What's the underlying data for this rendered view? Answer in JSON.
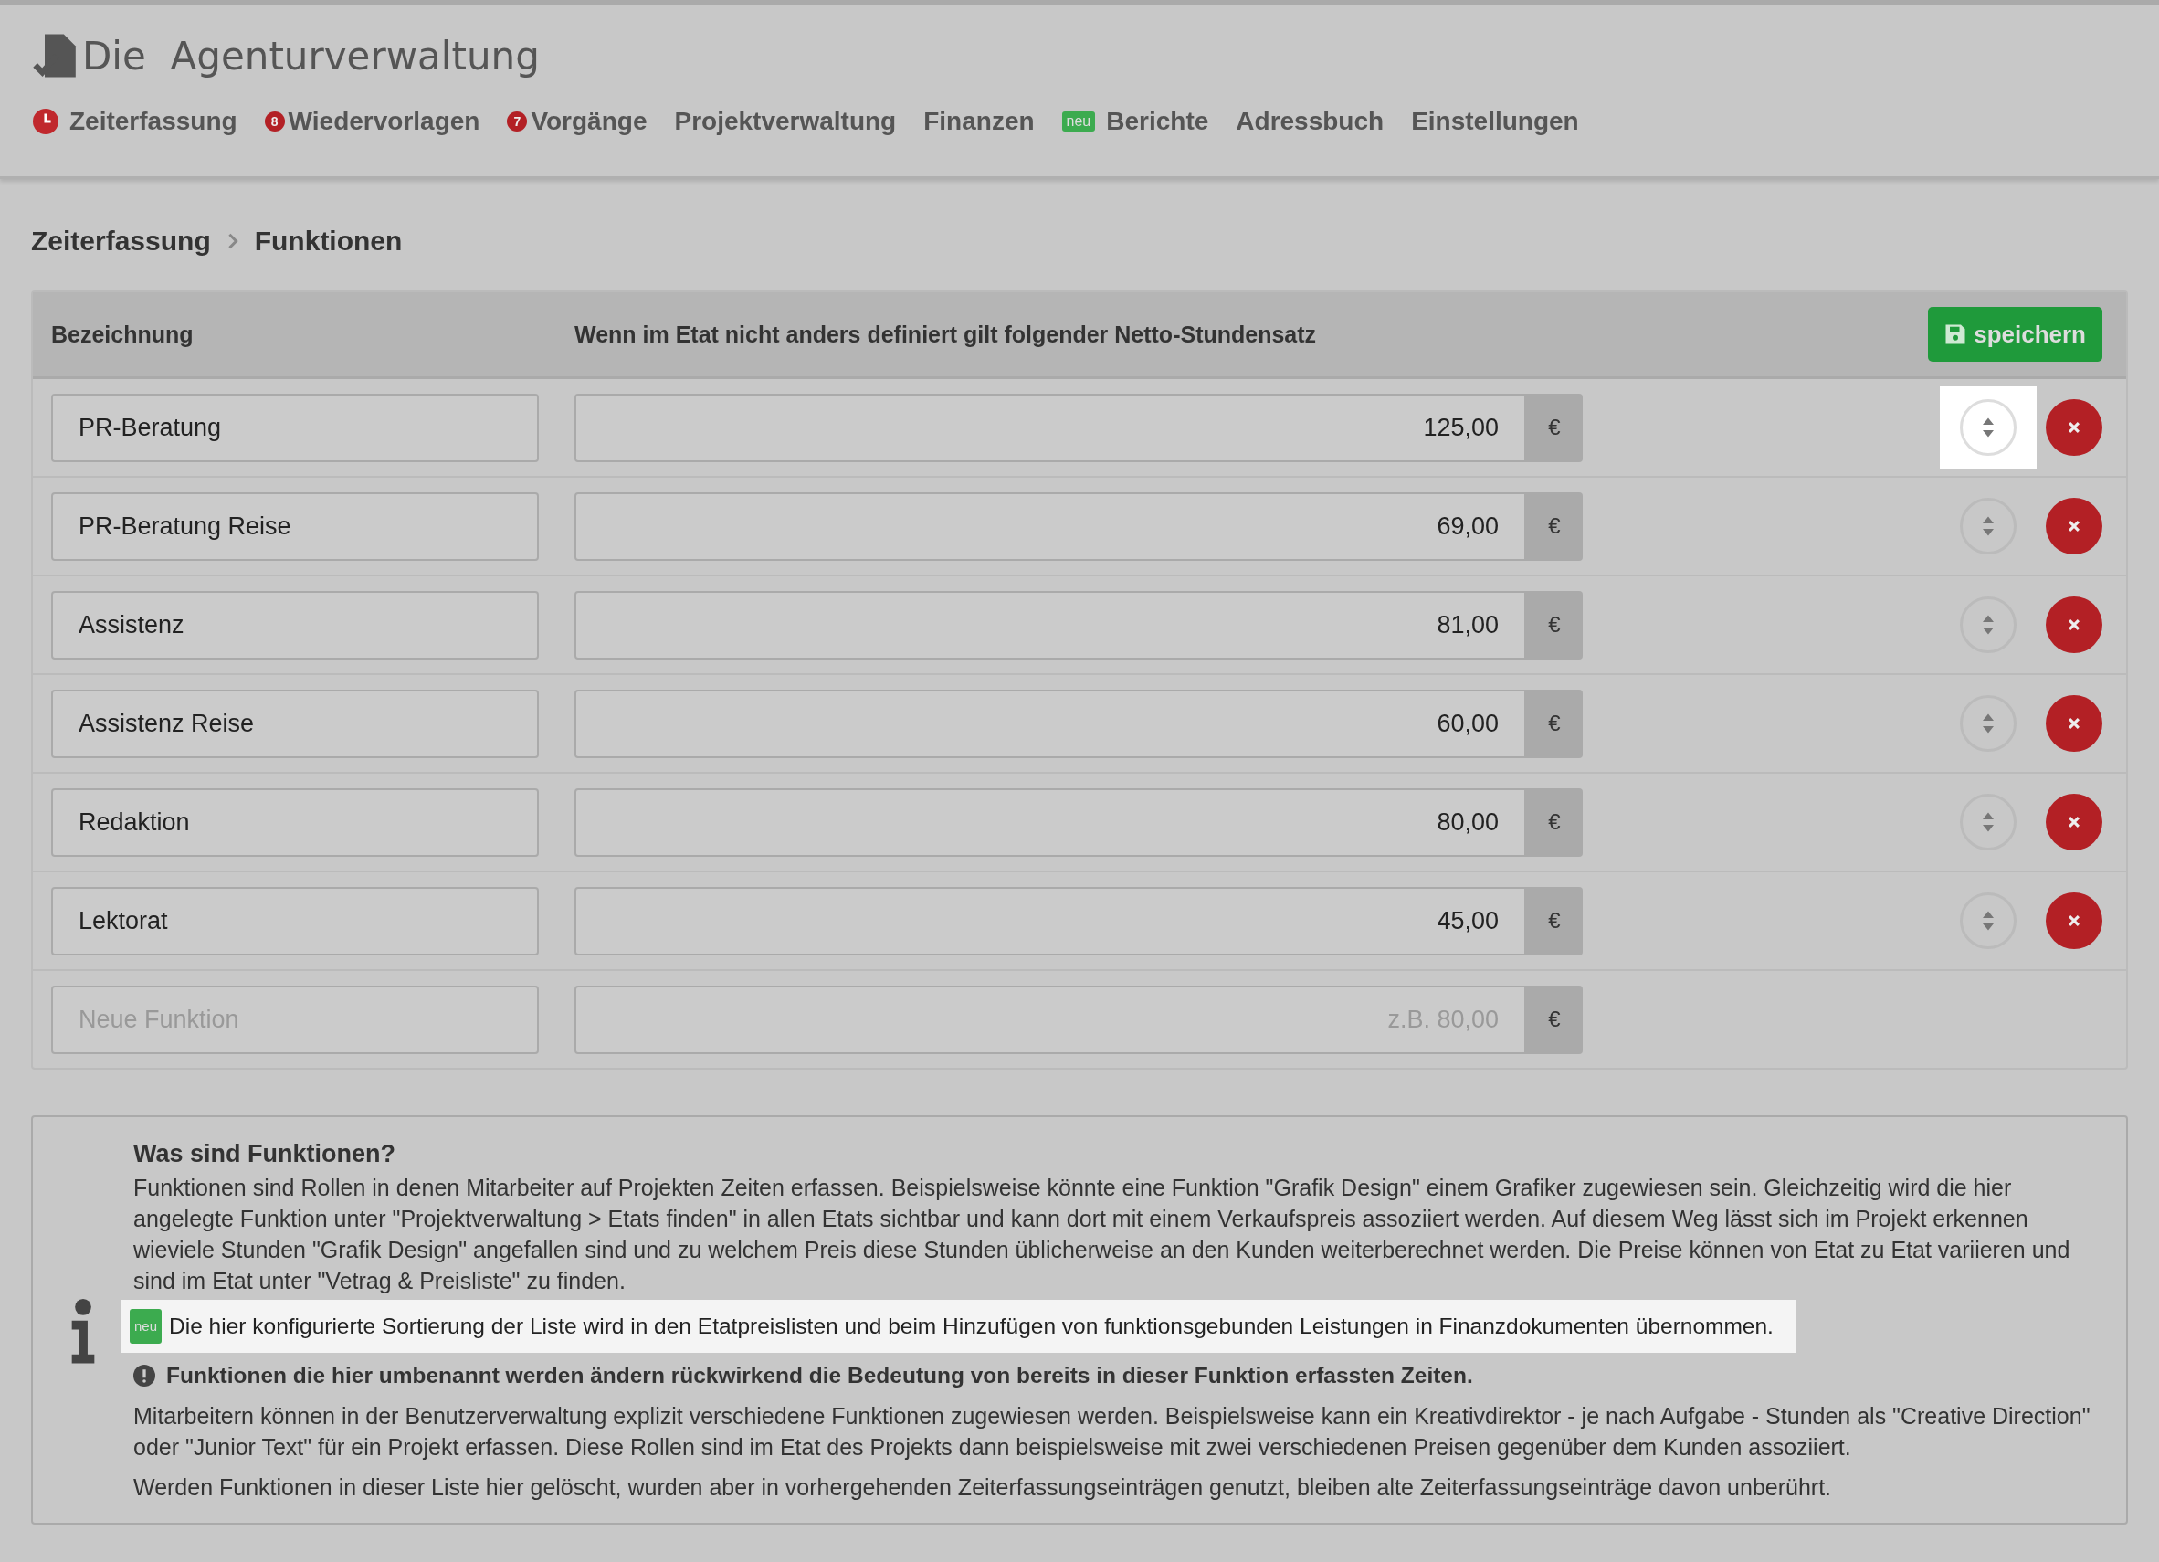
{
  "app": {
    "title": "Die  Agenturverwaltung"
  },
  "nav": [
    {
      "label": "Zeiterfassung",
      "kind": "clock"
    },
    {
      "label": "Wiedervorlagen",
      "kind": "count",
      "badge": "8"
    },
    {
      "label": "Vorgänge",
      "kind": "count",
      "badge": "7"
    },
    {
      "label": "Projektverwaltung",
      "kind": "plain"
    },
    {
      "label": "Finanzen",
      "kind": "plain"
    },
    {
      "label": "Berichte",
      "kind": "new",
      "badge": "neu"
    },
    {
      "label": "Adressbuch",
      "kind": "plain"
    },
    {
      "label": "Einstellungen",
      "kind": "plain"
    }
  ],
  "breadcrumb": [
    "Zeiterfassung",
    "Funktionen"
  ],
  "table": {
    "columns": [
      "Bezeichnung",
      "Wenn im Etat nicht anders definiert gilt folgender Netto-Stundensatz"
    ],
    "save_button": "speichern",
    "rows": [
      {
        "name": "PR-Beratung",
        "rate": "125,00",
        "currency": "€",
        "highlighted": true
      },
      {
        "name": "PR-Beratung Reise",
        "rate": "69,00",
        "currency": "€",
        "highlighted": false
      },
      {
        "name": "Assistenz",
        "rate": "81,00",
        "currency": "€",
        "highlighted": false
      },
      {
        "name": "Assistenz Reise",
        "rate": "60,00",
        "currency": "€",
        "highlighted": false
      },
      {
        "name": "Redaktion",
        "rate": "80,00",
        "currency": "€",
        "highlighted": false
      },
      {
        "name": "Lektorat",
        "rate": "45,00",
        "currency": "€",
        "highlighted": false
      }
    ],
    "new_row": {
      "name_placeholder": "Neue Funktion",
      "rate_placeholder": "z.B. 80,00",
      "currency": "€"
    }
  },
  "info": {
    "title": "Was sind Funktionen?",
    "blocks": [
      {
        "kind": "paragraph",
        "text": "Funktionen sind Rollen in denen Mitarbeiter auf Projekten Zeiten erfassen. Beispielsweise könnte eine Funktion \"Grafik Design\" einem Grafiker zugewiesen sein. Gleichzeitig wird die hier angelegte Funktion unter \"Projektverwaltung > Etats finden\" in allen Etats sichtbar und kann dort mit einem Verkaufspreis assoziiert werden. Auf diesem Weg lässt sich im Projekt erkennen wieviele Stunden \"Grafik Design\" angefallen sind und zu welchem Preis diese Stunden üblicherweise an den Kunden weiterberechnet werden. Die Preise können von Etat zu Etat variieren und sind im Etat unter \"Vetrag & Preisliste\" zu finden."
      },
      {
        "kind": "highlight",
        "badge": "neu",
        "text": "Die hier konfigurierte Sortierung der Liste wird in den Etatpreislisten und beim Hinzufügen von funktionsgebunden Leistungen in Finanzdokumenten übernommen."
      },
      {
        "kind": "warning",
        "text": "Funktionen die hier umbenannt werden ändern rückwirkend die Bedeutung von bereits in dieser Funktion erfassten Zeiten."
      },
      {
        "kind": "paragraph",
        "text": "Mitarbeitern können in der Benutzerverwaltung explizit verschiedene Funktionen zugewiesen werden. Beispielsweise kann ein Kreativdirektor - je nach Aufgabe - Stunden als \"Creative Direction\" oder \"Junior Text\" für ein Projekt erfassen. Diese Rollen sind im Etat des Projekts dann beispielsweise mit zwei verschiedenen Preisen gegenüber dem Kunden assoziiert."
      },
      {
        "kind": "paragraph",
        "text": "Werden Funktionen in dieser Liste hier gelöscht, wurden aber in vorhergehenden Zeiterfassungseinträgen genutzt, bleiben alte Zeiterfassungseinträge davon unberührt."
      }
    ]
  }
}
